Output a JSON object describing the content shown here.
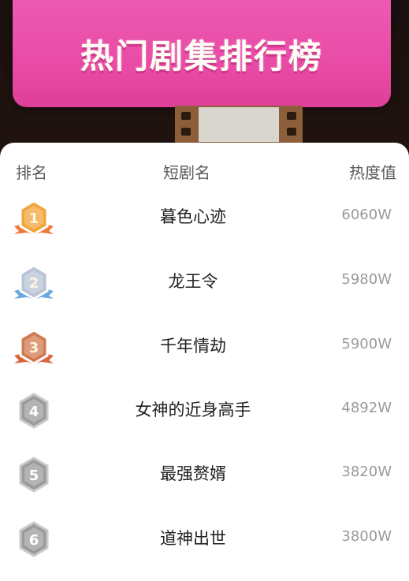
{
  "banner": {
    "title": "热门剧集排行榜"
  },
  "table": {
    "headers": {
      "rank": "排名",
      "name": "短剧名",
      "heat": "热度值"
    },
    "rows": [
      {
        "rank": "1",
        "name": "暮色心迹",
        "heat": "6060W",
        "medal": "gold"
      },
      {
        "rank": "2",
        "name": "龙王令",
        "heat": "5980W",
        "medal": "silver"
      },
      {
        "rank": "3",
        "name": "千年情劫",
        "heat": "5900W",
        "medal": "bronze"
      },
      {
        "rank": "4",
        "name": "女神的近身高手",
        "heat": "4892W",
        "medal": "plain"
      },
      {
        "rank": "5",
        "name": "最强赘婿",
        "heat": "3820W",
        "medal": "plain"
      },
      {
        "rank": "6",
        "name": "道神出世",
        "heat": "3800W",
        "medal": "plain"
      }
    ]
  },
  "colors": {
    "banner_pink": "#e84aa5",
    "gold": "#f2a53b",
    "silver": "#b9c3d6",
    "bronze": "#d07a52",
    "plain": "#9b9b9b"
  }
}
